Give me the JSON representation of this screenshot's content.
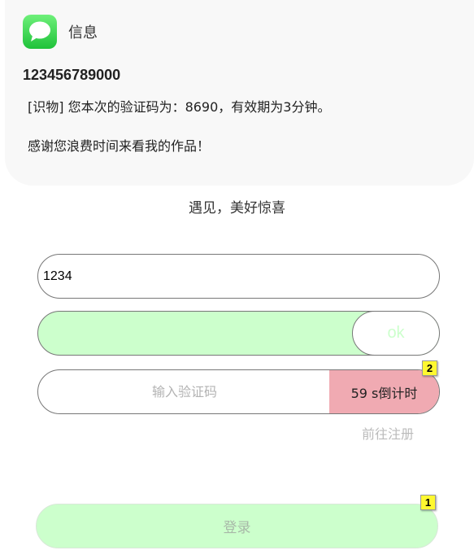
{
  "notification": {
    "app_icon": "messages-icon",
    "app_name": "信息",
    "sender": "123456789000",
    "message_line1": "[识物] 您本次的验证码为：8690，有效期为3分钟。",
    "message_line2": "感谢您浪费时间来看我的作品！"
  },
  "tagline": "遇见，美好惊喜",
  "form": {
    "phone_value": "1234",
    "slider_label": "ok",
    "slider_progress": 1.0,
    "code_placeholder": "输入验证码",
    "countdown_label": "59 s倒计时",
    "register_link": "前往注册",
    "login_label": "登录"
  },
  "markers": {
    "countdown": "2",
    "login": "1"
  },
  "colors": {
    "accent_green": "#ccffcc",
    "countdown_bg": "#f0aab2",
    "marker_yellow": "#fff830"
  }
}
